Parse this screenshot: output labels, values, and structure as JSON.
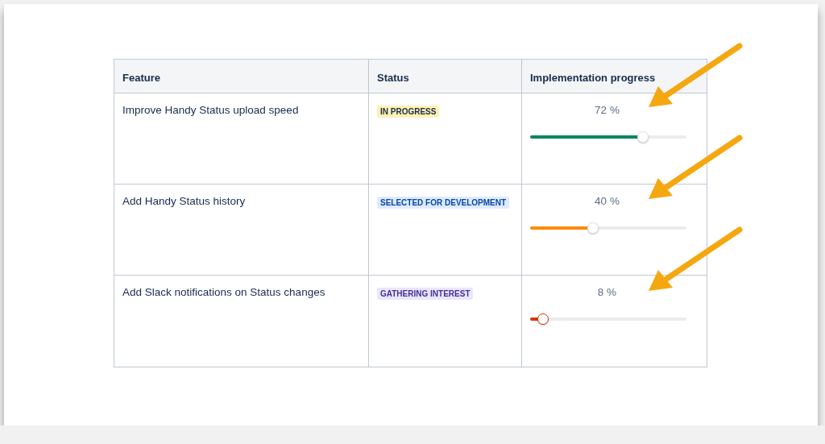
{
  "table": {
    "columns": [
      "Feature",
      "Status",
      "Implementation progress"
    ],
    "rows": [
      {
        "feature": "Improve Handy Status upload speed",
        "status": {
          "label": "IN PROGRESS",
          "kind": "yellow"
        },
        "progress": {
          "reading": "72 %",
          "level": 0.72,
          "color": "#00875a"
        }
      },
      {
        "feature": "Add Handy Status history",
        "status": {
          "label": "SELECTED FOR DEVELOPMENT",
          "kind": "blue"
        },
        "progress": {
          "reading": "40 %",
          "level": 0.4,
          "color": "#ff8b00"
        }
      },
      {
        "feature": "Add Slack notifications on Status changes",
        "status": {
          "label": "GATHERING INTEREST",
          "kind": "purple"
        },
        "progress": {
          "reading": "8 %",
          "level": 0.08,
          "color": "#de350b"
        }
      }
    ]
  }
}
